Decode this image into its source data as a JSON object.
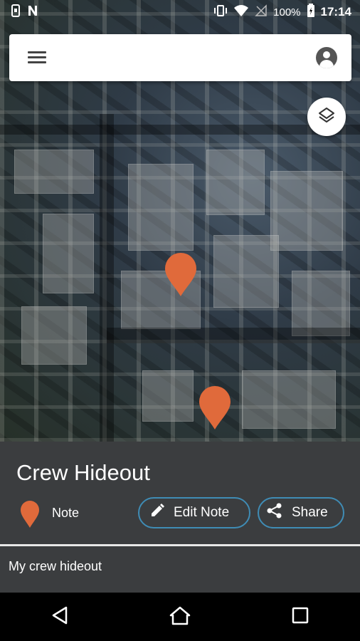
{
  "status_bar": {
    "battery": "100%",
    "time": "17:14"
  },
  "pin_color": "#e06a3b",
  "accent_color": "#3f8cb5",
  "place": {
    "title": "Crew Hideout",
    "type_label": "Note",
    "description": "My crew hideout"
  },
  "actions": {
    "edit_label": "Edit Note",
    "share_label": "Share"
  },
  "icons": [
    "menu-icon",
    "account-icon",
    "layers-icon",
    "map-pin-icon",
    "pencil-icon",
    "share-icon",
    "back-icon",
    "home-icon",
    "recents-icon"
  ]
}
